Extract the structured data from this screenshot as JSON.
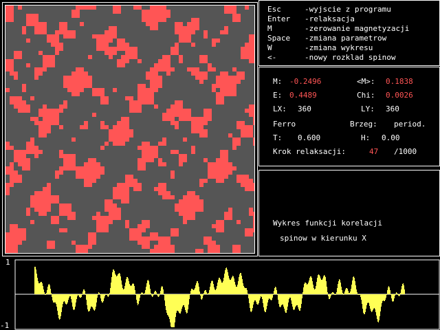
{
  "help": [
    {
      "key": "Esc",
      "desc": "-wyjscie z programu"
    },
    {
      "key": "Enter",
      "desc": "-relaksacja"
    },
    {
      "key": "M",
      "desc": "-zerowanie magnetyzacji"
    },
    {
      "key": "Space",
      "desc": "-zmiana parametrow"
    },
    {
      "key": "W",
      "desc": "-zmiana wykresu"
    },
    {
      "key": "<-",
      "desc": "-nowy rozklad spinow"
    }
  ],
  "params": {
    "M_label": "M:",
    "M_value": "-0.2496",
    "avgM_label": "<M>:",
    "avgM_value": "0.1838",
    "E_label": "E:",
    "E_value": "0.4489",
    "Chi_label": "Chi:",
    "Chi_value": "0.0026",
    "LX_label": "LX:",
    "LX_value": "360",
    "LY_label": "LY:",
    "LY_value": "360",
    "type": "Ferro",
    "brzeg_label": "Brzeg:",
    "brzeg_value": "period.",
    "T_label": "T:",
    "T_value": "0.600",
    "H_label": "H:",
    "H_value": "0.00",
    "krok_label": "Krok relaksacji:",
    "krok_value": "47",
    "krok_total": "/1000"
  },
  "corr_panel": {
    "line1": "Wykres funkcji korelacji",
    "line2": "spinow w kierunku X"
  },
  "plot": {
    "ymax_label": "1",
    "ymin_label": "-1"
  },
  "colors": {
    "spin_up": "#ff5555",
    "spin_down": "#555555",
    "plot": "#ffff55",
    "accent": "#ff5555"
  }
}
